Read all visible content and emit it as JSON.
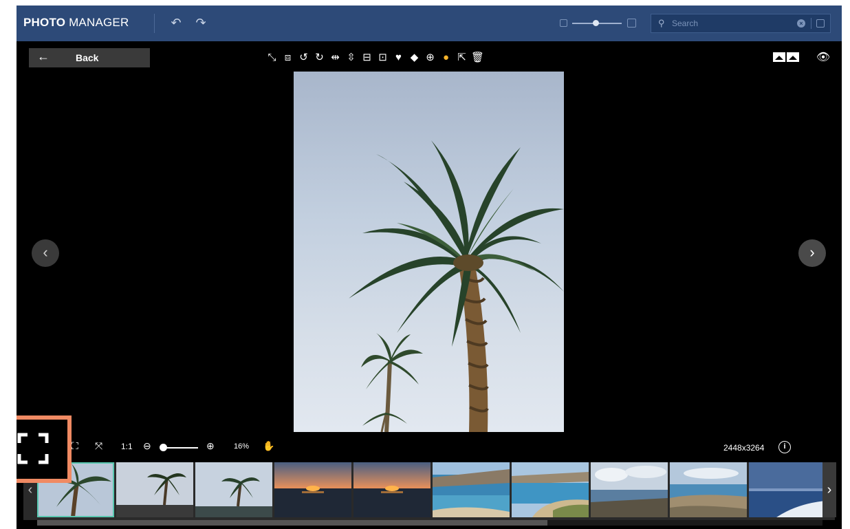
{
  "app": {
    "brand_bold": "PHOTO",
    "brand_rest": " MANAGER"
  },
  "search": {
    "placeholder": "Search",
    "value": ""
  },
  "toolbar": {
    "back_label": "Back",
    "tools": [
      {
        "name": "auto-enhance-icon",
        "glyph": "⤡"
      },
      {
        "name": "crop-icon",
        "glyph": "⧈"
      },
      {
        "name": "rotate-left-icon",
        "glyph": "↺"
      },
      {
        "name": "rotate-right-icon",
        "glyph": "↻"
      },
      {
        "name": "flip-horizontal-icon",
        "glyph": "⇹"
      },
      {
        "name": "flip-vertical-icon",
        "glyph": "⇳"
      },
      {
        "name": "straighten-icon",
        "glyph": "⊟"
      },
      {
        "name": "resize-icon",
        "glyph": "⊡"
      },
      {
        "name": "favorite-heart-icon",
        "glyph": "♥"
      },
      {
        "name": "tag-icon",
        "glyph": "◆"
      },
      {
        "name": "add-to-album-icon",
        "glyph": "⊕"
      },
      {
        "name": "color-icon",
        "glyph": "●"
      },
      {
        "name": "share-icon",
        "glyph": "⇱"
      },
      {
        "name": "delete-icon",
        "glyph": "🗑"
      }
    ]
  },
  "bottom": {
    "one_to_one": "1:1",
    "zoom_percent": "16%",
    "zoom_level": 0.16,
    "dimensions": "2448x3264",
    "info_glyph": "i"
  },
  "filmstrip": {
    "selected_index": 0,
    "scroll_fraction": 0.65,
    "thumbs": [
      {
        "kind": "palm-close"
      },
      {
        "kind": "palm-dusk"
      },
      {
        "kind": "palm-far"
      },
      {
        "kind": "sunset"
      },
      {
        "kind": "sunset"
      },
      {
        "kind": "coast-blue"
      },
      {
        "kind": "coast-beach"
      },
      {
        "kind": "clouds-sea"
      },
      {
        "kind": "coast-rocks"
      },
      {
        "kind": "sea-horizon"
      }
    ]
  },
  "colors": {
    "topbar": "#2d4a78",
    "highlight": "#f08a63",
    "selected_thumb": "#58c7b0"
  }
}
